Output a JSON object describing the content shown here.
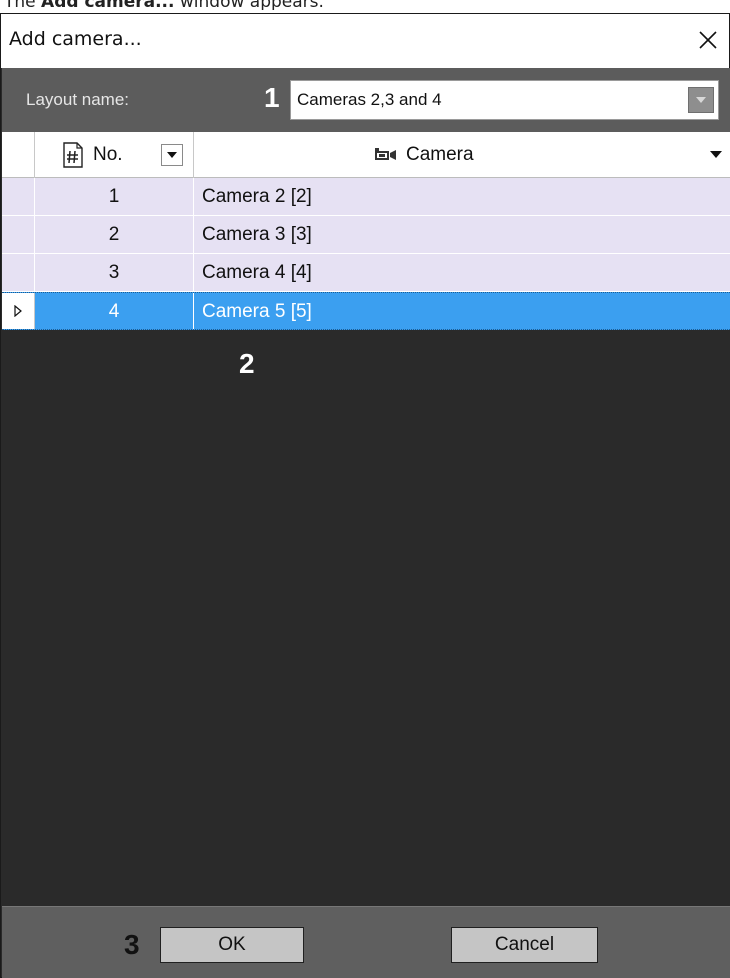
{
  "caption": {
    "prefix": "The ",
    "bold": "Add camera...",
    "suffix": " window appears."
  },
  "window": {
    "title": "Add camera...",
    "close_icon": "close-icon"
  },
  "layout": {
    "label": "Layout name:",
    "value": "Cameras 2,3 and 4",
    "dropdown_icon": "chevron-down-icon"
  },
  "callouts": {
    "one": "1",
    "two": "2",
    "three": "3"
  },
  "grid": {
    "columns": {
      "no": "No.",
      "camera": "Camera"
    },
    "rows": [
      {
        "no": "1",
        "camera": "Camera 2 [2]"
      },
      {
        "no": "2",
        "camera": "Camera 3 [3]"
      },
      {
        "no": "3",
        "camera": "Camera 4 [4]"
      },
      {
        "no": "4",
        "camera": "Camera 5 [5]",
        "selected": true
      }
    ],
    "colors": {
      "row_bg": "#e6e1f3",
      "selected_bg": "#3b9ff0",
      "empty_bg": "#2a2a2a"
    }
  },
  "footer": {
    "ok_label": "OK",
    "cancel_label": "Cancel"
  }
}
